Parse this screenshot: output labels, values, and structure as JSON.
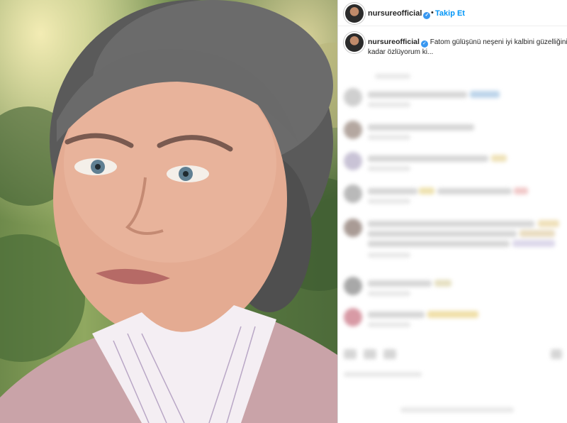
{
  "photo": {
    "alt_subject": "portrait"
  },
  "header": {
    "username": "nursureofficial",
    "dot": "•",
    "follow_label": "Takip Et"
  },
  "caption": {
    "username": "nursureofficial",
    "text": "Fatom gülüşünü neşeni iyi kalbini güzelliğini o kadar özlüyorum ki..."
  },
  "colors": {
    "follow_blue": "#0095f6",
    "verified_blue": "#3897f0",
    "text_dark": "#262626"
  },
  "icons": [
    "verified-badge-icon"
  ]
}
